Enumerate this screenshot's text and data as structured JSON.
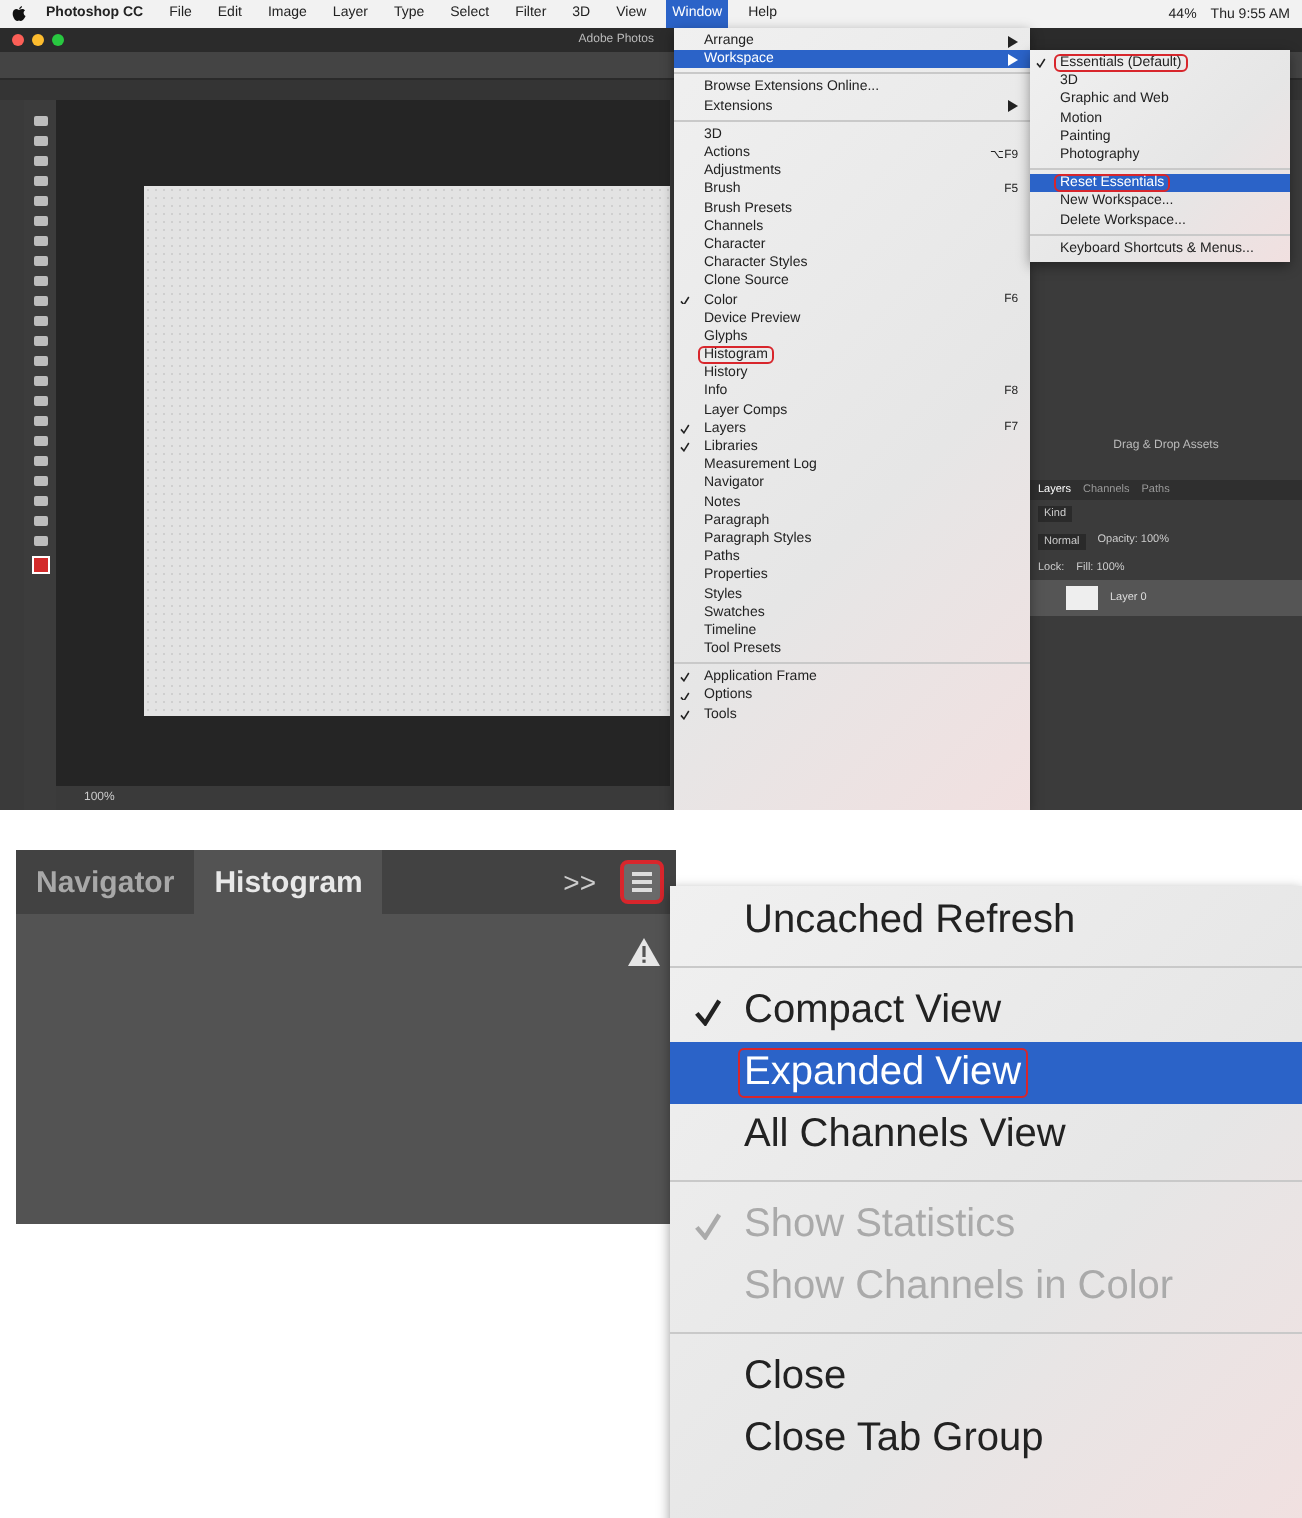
{
  "top_screenshot": {
    "menu_bar": {
      "items": [
        {
          "label": "Photoshop CC",
          "selected": false,
          "bold": true
        },
        {
          "label": "File",
          "selected": false
        },
        {
          "label": "Edit",
          "selected": false
        },
        {
          "label": "Image",
          "selected": false
        },
        {
          "label": "Layer",
          "selected": false
        },
        {
          "label": "Type",
          "selected": false
        },
        {
          "label": "Select",
          "selected": false
        },
        {
          "label": "Filter",
          "selected": false
        },
        {
          "label": "3D",
          "selected": false
        },
        {
          "label": "View",
          "selected": false
        },
        {
          "label": "Window",
          "selected": true
        },
        {
          "label": "Help",
          "selected": false
        }
      ],
      "status": [
        "44%",
        "Thu 9:55 AM"
      ]
    },
    "window_title": "Adobe Photos",
    "status_bar": {
      "zoom": "100%"
    },
    "window_menu": {
      "items": [
        {
          "kind": "item",
          "label": "Arrange",
          "submenu": true
        },
        {
          "kind": "item",
          "label": "Workspace",
          "submenu": true,
          "selected": true
        },
        {
          "kind": "separator"
        },
        {
          "kind": "item",
          "label": "Browse Extensions Online..."
        },
        {
          "kind": "item",
          "label": "Extensions",
          "submenu": true
        },
        {
          "kind": "separator"
        },
        {
          "kind": "item",
          "label": "3D"
        },
        {
          "kind": "item",
          "label": "Actions",
          "shortcut": "⌥F9"
        },
        {
          "kind": "item",
          "label": "Adjustments"
        },
        {
          "kind": "item",
          "label": "Brush",
          "shortcut": "F5"
        },
        {
          "kind": "item",
          "label": "Brush Presets"
        },
        {
          "kind": "item",
          "label": "Channels"
        },
        {
          "kind": "item",
          "label": "Character"
        },
        {
          "kind": "item",
          "label": "Character Styles"
        },
        {
          "kind": "item",
          "label": "Clone Source"
        },
        {
          "kind": "item",
          "label": "Color",
          "shortcut": "F6",
          "checked": true
        },
        {
          "kind": "item",
          "label": "Device Preview"
        },
        {
          "kind": "item",
          "label": "Glyphs"
        },
        {
          "kind": "item",
          "label": "Histogram",
          "outlined": true
        },
        {
          "kind": "item",
          "label": "History"
        },
        {
          "kind": "item",
          "label": "Info",
          "shortcut": "F8"
        },
        {
          "kind": "item",
          "label": "Layer Comps"
        },
        {
          "kind": "item",
          "label": "Layers",
          "shortcut": "F7",
          "checked": true
        },
        {
          "kind": "item",
          "label": "Libraries",
          "checked": true
        },
        {
          "kind": "item",
          "label": "Measurement Log"
        },
        {
          "kind": "item",
          "label": "Navigator"
        },
        {
          "kind": "item",
          "label": "Notes"
        },
        {
          "kind": "item",
          "label": "Paragraph"
        },
        {
          "kind": "item",
          "label": "Paragraph Styles"
        },
        {
          "kind": "item",
          "label": "Paths"
        },
        {
          "kind": "item",
          "label": "Properties"
        },
        {
          "kind": "item",
          "label": "Styles"
        },
        {
          "kind": "item",
          "label": "Swatches"
        },
        {
          "kind": "item",
          "label": "Timeline"
        },
        {
          "kind": "item",
          "label": "Tool Presets"
        },
        {
          "kind": "separator"
        },
        {
          "kind": "item",
          "label": "Application Frame",
          "checked": true
        },
        {
          "kind": "item",
          "label": "Options",
          "checked": true
        },
        {
          "kind": "item",
          "label": "Tools",
          "checked": true
        }
      ]
    },
    "workspace_menu": {
      "items": [
        {
          "kind": "item",
          "label": "Essentials (Default)",
          "checked": true,
          "outlined": true
        },
        {
          "kind": "item",
          "label": "3D"
        },
        {
          "kind": "item",
          "label": "Graphic and Web"
        },
        {
          "kind": "item",
          "label": "Motion"
        },
        {
          "kind": "item",
          "label": "Painting"
        },
        {
          "kind": "item",
          "label": "Photography"
        },
        {
          "kind": "separator"
        },
        {
          "kind": "item",
          "label": "Reset Essentials",
          "selected": true,
          "outlined": true
        },
        {
          "kind": "item",
          "label": "New Workspace..."
        },
        {
          "kind": "item",
          "label": "Delete Workspace..."
        },
        {
          "kind": "separator"
        },
        {
          "kind": "item",
          "label": "Keyboard Shortcuts & Menus..."
        }
      ]
    },
    "libraries_panel": {
      "hint": "Drag & Drop Assets"
    },
    "layers_panel": {
      "tabs": [
        {
          "label": "Layers",
          "selected": true
        },
        {
          "label": "Channels",
          "selected": false
        },
        {
          "label": "Paths",
          "selected": false
        }
      ],
      "filter": "Kind",
      "blend_mode": "Normal",
      "opacity": "Opacity: 100%",
      "lock": "Lock:",
      "fill": "Fill: 100%",
      "layers": [
        {
          "name": "Layer 0",
          "selected": true
        }
      ]
    }
  },
  "bottom_screenshot": {
    "panel": {
      "tabs": [
        {
          "label": "Navigator",
          "selected": false
        },
        {
          "label": "Histogram",
          "selected": true
        }
      ],
      "more": ">>"
    },
    "panel_menu": {
      "items": [
        {
          "kind": "item",
          "label": "Uncached Refresh"
        },
        {
          "kind": "separator"
        },
        {
          "kind": "item",
          "label": "Compact View",
          "checked": true
        },
        {
          "kind": "item",
          "label": "Expanded View",
          "selected": true,
          "outlined": true
        },
        {
          "kind": "item",
          "label": "All Channels View"
        },
        {
          "kind": "separator"
        },
        {
          "kind": "item",
          "label": "Show Statistics",
          "checked": true,
          "disabled": true
        },
        {
          "kind": "item",
          "label": "Show Channels in Color",
          "disabled": true
        },
        {
          "kind": "separator"
        },
        {
          "kind": "item",
          "label": "Close"
        },
        {
          "kind": "item",
          "label": "Close Tab Group"
        }
      ]
    }
  }
}
